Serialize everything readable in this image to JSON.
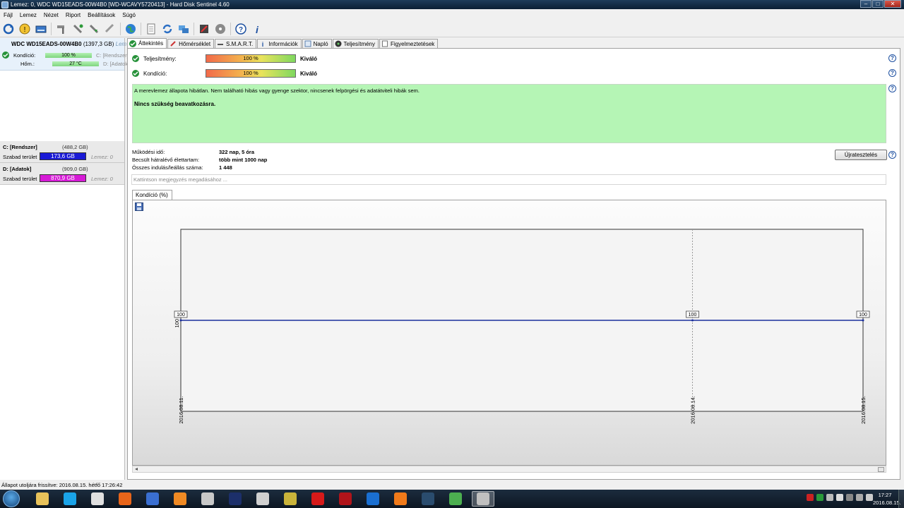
{
  "window": {
    "title": "Lemez: 0, WDC WD15EADS-00W4B0 [WD-WCAVY5720413]  -  Hard Disk Sentinel 4.60",
    "controls": [
      "–",
      "□",
      "✕"
    ]
  },
  "menu": [
    "Fájl",
    "Lemez",
    "Nézet",
    "Riport",
    "Beállítások",
    "Súgó"
  ],
  "toolbar_icons": [
    "refresh-icon",
    "warning-icon",
    "drive-icon",
    "hammer-icon",
    "wrench-icon",
    "wrench-down-icon",
    "tool-icon",
    "globe-icon",
    "document-icon",
    "sync-icon",
    "network-icon",
    "tasks-icon",
    "disc-icon",
    "help-icon",
    "info-icon"
  ],
  "disk": {
    "name": "WDC WD15EADS-00W4B0",
    "size": "(1397,3 GB)",
    "extra": "Lem",
    "kondicio_label": "Kondíció:",
    "kondicio_value": "100 %",
    "kondicio_vol": "C: [Rendszer],",
    "hom_label": "Hőm.:",
    "hom_value": "27 °C",
    "hom_vol": "D: [Adatok], ["
  },
  "volumes": [
    {
      "name": "C: [Rendszer]",
      "size": "(488,2 GB)",
      "free_label": "Szabad terület",
      "free": "173,6 GB",
      "lemez": "Lemez: 0",
      "color": "#1a1ad6"
    },
    {
      "name": "D: [Adatok]",
      "size": "(909,0 GB)",
      "free_label": "Szabad terület",
      "free": "870,9 GB",
      "lemez": "Lemez: 0",
      "color": "#d61ad6"
    }
  ],
  "tabs": [
    "Áttekintés",
    "Hőmérséklet",
    "S.M.A.R.T.",
    "Információk",
    "Napló",
    "Teljesítmény",
    "Figyelmeztetések"
  ],
  "overview": {
    "teljesitmeny_label": "Teljesítmény:",
    "teljesitmeny_value": "100 %",
    "teljesitmeny_rating": "Kiváló",
    "kondicio_label": "Kondíció:",
    "kondicio_value": "100 %",
    "kondicio_rating": "Kiváló",
    "message1": "A merevlemez állapota hibátlan. Nem található hibás vagy gyenge szektor, nincsenek felpörgési és adatátviteli hibák sem.",
    "message2": "Nincs szükség beavatkozásra.",
    "mukodesi_label": "Működési idő:",
    "mukodesi_value": "322 nap, 5 óra",
    "elettartam_label": "Becsült hátralévő élettartam:",
    "elettartam_value": "több mint 1000 nap",
    "indulas_label": "Összes indulás/leállás száma:",
    "indulas_value": "1 448",
    "reset_button": "Újratesztelés",
    "note_placeholder": "Kattintson megjegyzés megadásához ...",
    "help": "?"
  },
  "chart_tab": "Kondíció  (%)",
  "chart_data": {
    "type": "line",
    "x": [
      "2016.08.11.",
      "2016.08.14.",
      "2016.08.15."
    ],
    "y": [
      100,
      100,
      100
    ],
    "ytick": "100",
    "data_labels": [
      "100",
      "100",
      "100"
    ],
    "grid": true,
    "color": "#1a2f9c"
  },
  "statusbar": "Állapot utoljára frissítve: 2016.08.15. hétfő 17:26:42",
  "taskbar": {
    "time": "17:27",
    "date": "2016.08.15.",
    "apps": [
      {
        "name": "explorer-icon",
        "color": "#e8c25a"
      },
      {
        "name": "skype-icon",
        "color": "#1aa3e8"
      },
      {
        "name": "media-player-icon",
        "color": "#e0e0e0"
      },
      {
        "name": "firefox-icon",
        "color": "#e8651a"
      },
      {
        "name": "save-app-icon",
        "color": "#3a6fd1"
      },
      {
        "name": "blender-icon",
        "color": "#f08a24"
      },
      {
        "name": "mpc-icon",
        "color": "#c8c8c8"
      },
      {
        "name": "photoshop-icon",
        "color": "#1c2f6a"
      },
      {
        "name": "video-editor-icon",
        "color": "#d0d0d0"
      },
      {
        "name": "foobar-icon",
        "color": "#c9b33a"
      },
      {
        "name": "record-icon",
        "color": "#d61a1a"
      },
      {
        "name": "media-disc-icon",
        "color": "#b0141a"
      },
      {
        "name": "uplay-icon",
        "color": "#1a6fd1"
      },
      {
        "name": "origin-icon",
        "color": "#f07a1a"
      },
      {
        "name": "steam-icon",
        "color": "#2a4c6e"
      },
      {
        "name": "chrome-icon",
        "color": "#4caf50"
      },
      {
        "name": "hdsentinel-icon",
        "color": "#c0c0c0"
      }
    ]
  }
}
